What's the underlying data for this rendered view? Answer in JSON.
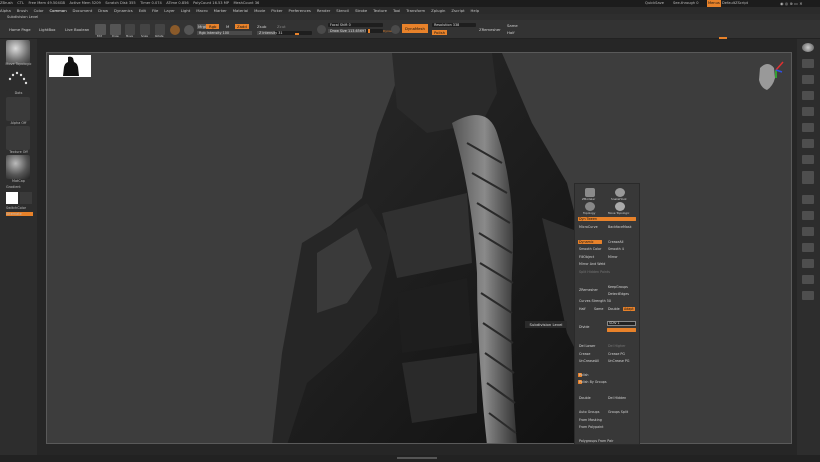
{
  "titlebar": {
    "app": "ZBrush",
    "items": [
      "CTL",
      "Free Mem 49.504GB",
      "Active Mem 5209",
      "Scratch Disk 355",
      "Timer 0.074",
      "ATime 0.856",
      "PolyCount 16.53 MP",
      "MeshCount 36"
    ],
    "right_items": [
      "QuickSave",
      "See-through 0",
      "Menus",
      "DefaultZScript"
    ]
  },
  "menubar": {
    "items": [
      "Alpha",
      "Brush",
      "Color",
      "Document",
      "Draw",
      "Dynamics",
      "Edit",
      "File",
      "Layer",
      "Light",
      "Macro",
      "Marker",
      "Material",
      "Movie",
      "Picker",
      "Preferences",
      "Render",
      "Stencil",
      "Stroke",
      "Texture",
      "Tool",
      "Transform",
      "Zplugin",
      "Zscript",
      "Help"
    ],
    "active": "Common"
  },
  "subbar": {
    "label": "Subdivision Level"
  },
  "topshelf": {
    "home_page": "Home Page",
    "lightbox": "LightBox",
    "live_boolean": "Live Boolean",
    "edit": "Edit",
    "draw": "Draw",
    "move": "Move",
    "scale": "Scale",
    "rotate": "Rotate",
    "mrgb": "Mrgb",
    "rgb": "Rgb",
    "m": "M",
    "zadd": "Zadd",
    "zsub": "Zsub",
    "zcut": "Zcut",
    "rgb_intensity": "Rgb Intensity 100",
    "z_intensity": "Z Intensity 31",
    "focal_shift": "Focal Shift 0",
    "draw_size": "Draw Size 113.65697",
    "dynamic": "Dynamic",
    "dynamesh": "DynaMesh",
    "resolution": "Resolution 338",
    "polish": "Polish",
    "zremesher": "ZRemesher",
    "same": "Same",
    "half": "Half"
  },
  "leftshelf": {
    "brush_label": "Move Topologic",
    "stroke_label": "Dots",
    "alpha_label": "Alpha Off",
    "texture_label": "Texture Off",
    "material_label": "MatCap",
    "gradient_label": "Gradient",
    "switch_color": "SwitchColor",
    "alternate": "Alternate"
  },
  "canvas": {
    "bg_color": "#3d3d3d",
    "tooltip": "Subdivision Level"
  },
  "popup": {
    "thumbs": [
      "ZModeler",
      "SnakeHook",
      "Topology",
      "Move Topologic"
    ],
    "rows": [
      {
        "a": "Dyn Tween",
        "b": ""
      },
      {
        "a": "MicroCurve",
        "b": "BackfaceMask"
      },
      {
        "a": "Dynamic",
        "b": "CreaseAll"
      },
      {
        "a": "Smooth Color",
        "b": "Smooth 4"
      },
      {
        "a": "FillObject",
        "b": "Mirror"
      },
      {
        "a": "Mirror And Weld",
        "b": ""
      },
      {
        "a": "Split Hidden Points",
        "b": ""
      },
      {
        "a": "ZRemesher",
        "b": "KeepGroups"
      },
      {
        "a": "",
        "b": "DetectEdges"
      },
      {
        "a": "Curves Strength 50",
        "b": ""
      },
      {
        "a": "Half",
        "b": "Same"
      },
      {
        "a": "Double",
        "b": "Adapt"
      },
      {
        "a": "Divide",
        "b": "SDiv 1"
      },
      {
        "a": "Del Lower",
        "b": "Del Higher"
      },
      {
        "a": "Crease",
        "b": "Crease PG"
      },
      {
        "a": "UnCreaseAll",
        "b": "UnCrease PG"
      },
      {
        "a": "Polish",
        "b": ""
      },
      {
        "a": "Polish By Groups",
        "b": ""
      },
      {
        "a": "Double",
        "b": "Del Hidden"
      },
      {
        "a": "Auto Groups",
        "b": "Groups Split"
      },
      {
        "a": "From Masking",
        "b": ""
      },
      {
        "a": "From Polypaint",
        "b": ""
      },
      {
        "a": "Polygroups From Pair",
        "b": ""
      }
    ]
  },
  "colors": {
    "accent": "#e8822a",
    "ui_bg": "#333333",
    "canvas": "#3d3d3d"
  }
}
